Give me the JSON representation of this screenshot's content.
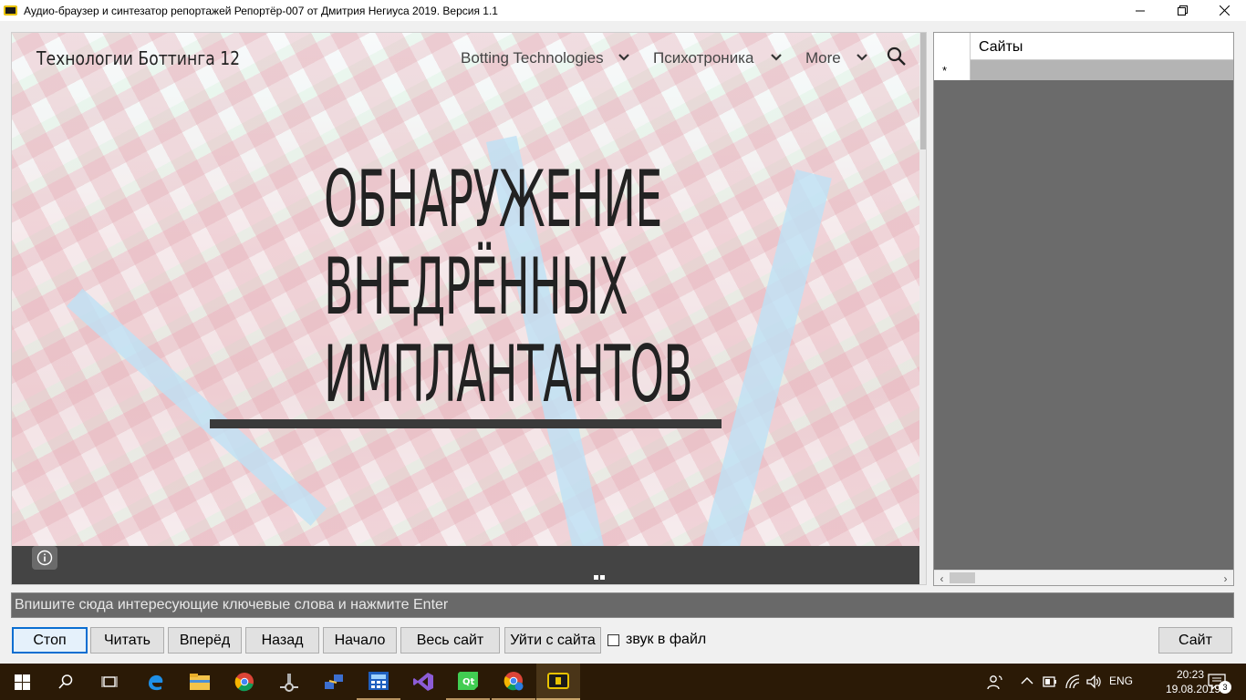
{
  "window": {
    "title": "Аудио-браузер и синтезатор репортажей Репортёр-007 от Дмитрия Негиуса 2019.  Версия 1.1",
    "controls": {
      "minimize": "—",
      "maximize": "❐",
      "close": "✕"
    }
  },
  "webpage": {
    "site_title": "Технологии Боттинга 12",
    "nav": [
      {
        "label": "Botting Technologies",
        "icon": "chevron-down-icon"
      },
      {
        "label": "Психотроника",
        "icon": "chevron-down-icon"
      },
      {
        "label": "More",
        "icon": "chevron-down-icon"
      }
    ],
    "search_icon": "search-icon",
    "headline_lines": [
      "ОБНАРУЖЕНИЕ",
      "ВНЕДРЁННЫХ",
      "ИМПЛАНТАНТОВ"
    ],
    "info_icon": "info-icon"
  },
  "grid": {
    "column_header": "Сайты",
    "new_row_marker": "*"
  },
  "keyword_input": {
    "value": "Впишите сюда интересующие ключевые слова и нажмите Enter"
  },
  "buttons": {
    "stop": "Стоп",
    "read": "Читать",
    "forward": "Вперёд",
    "back": "Назад",
    "start": "Начало",
    "whole_site": "Весь сайт",
    "leave_site": "Уйти с сайта",
    "site": "Сайт"
  },
  "sound_to_file": {
    "label": "звук в файл",
    "checked": false
  },
  "taskbar": {
    "apps": [
      "windows-start-icon",
      "search-icon",
      "task-view-icon",
      "edge-icon",
      "file-explorer-icon",
      "chrome-icon",
      "tool-icon",
      "network-icon",
      "calculator-app-icon",
      "visual-studio-icon",
      "qt-icon",
      "chrome-profile-icon",
      "reporter-app-icon"
    ],
    "language": "ENG",
    "time": "20:23",
    "date": "19.08.2019",
    "notifications": "3"
  },
  "colors": {
    "grid_background": "#6b6b6b",
    "input_background": "#696969",
    "taskbar": "#2b1a06",
    "default_button_border": "#0a6ed1"
  }
}
